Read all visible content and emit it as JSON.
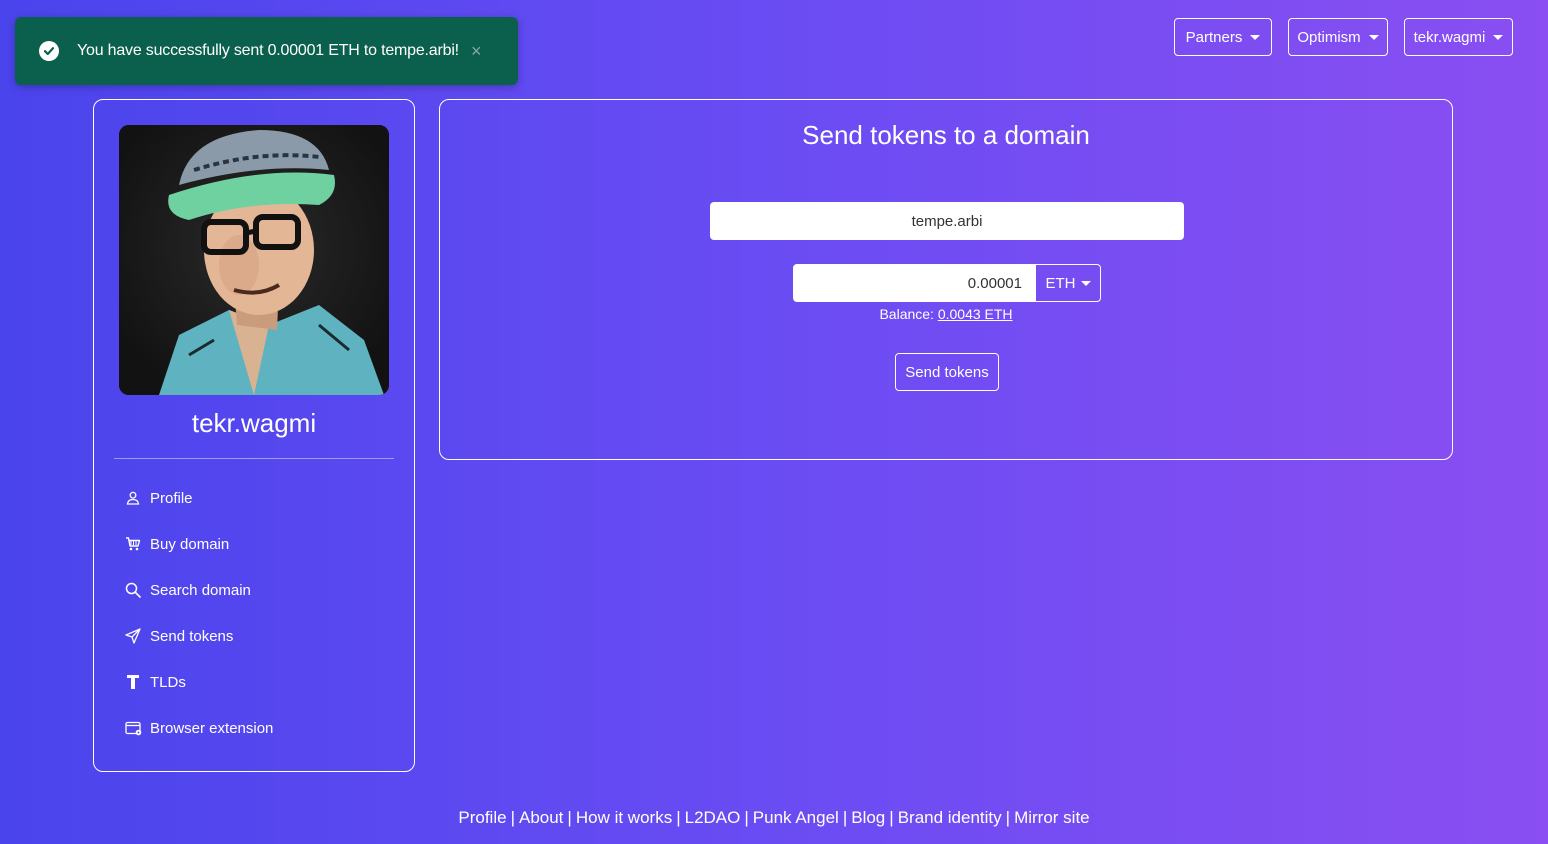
{
  "toast": {
    "message": "You have successfully sent 0.00001 ETH to tempe.arbi!",
    "close_glyph": "×",
    "color": "#0b5f4d"
  },
  "topnav": {
    "partners_label": "Partners",
    "network_label": "Optimism",
    "account_label": "tekr.wagmi"
  },
  "sidebar": {
    "username": "tekr.wagmi",
    "items": [
      {
        "label": "Profile",
        "icon": "person-icon"
      },
      {
        "label": "Buy domain",
        "icon": "cart-icon"
      },
      {
        "label": "Search domain",
        "icon": "search-icon"
      },
      {
        "label": "Send tokens",
        "icon": "send-icon"
      },
      {
        "label": "TLDs",
        "icon": "tld-icon"
      },
      {
        "label": "Browser extension",
        "icon": "browser-icon"
      }
    ]
  },
  "main": {
    "title": "Send tokens to a domain",
    "domain_value": "tempe.arbi",
    "amount_value": "0.00001",
    "token_label": "ETH",
    "balance_label": "Balance:",
    "balance_value": "0.0043 ETH",
    "send_label": "Send tokens"
  },
  "footer": {
    "links": [
      "Profile",
      "About",
      "How it works",
      "L2DAO",
      "Punk Angel",
      "Blog",
      "Brand identity",
      "Mirror site"
    ],
    "separator": "|"
  },
  "colors": {
    "background_start": "#4a44ec",
    "background_end": "#8a4ef2"
  }
}
